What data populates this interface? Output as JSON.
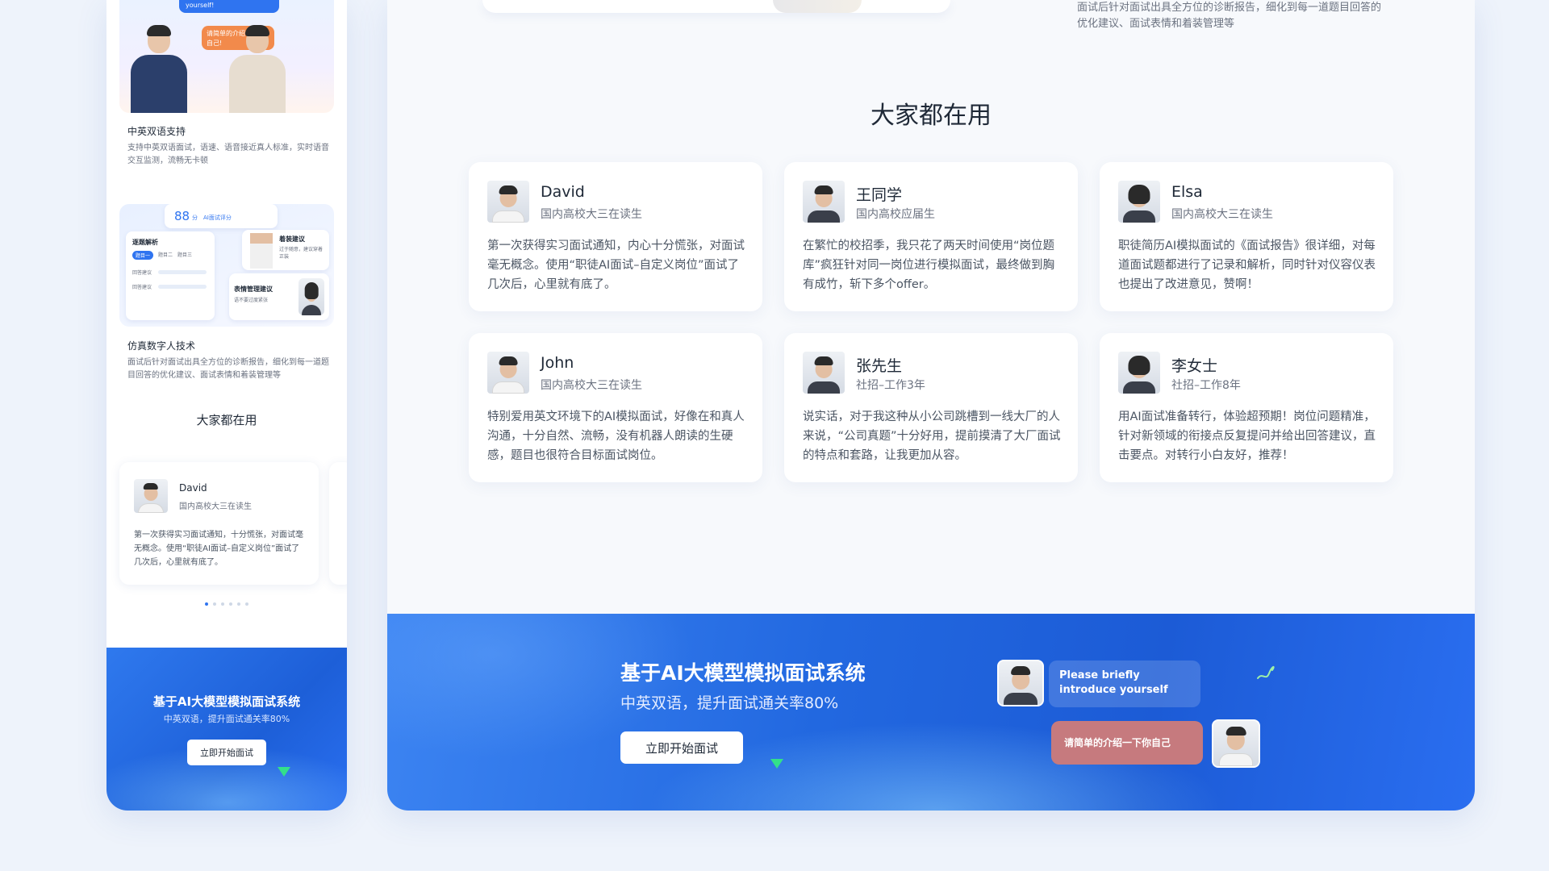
{
  "mobile": {
    "hero": {
      "bubble_en": "yourself!",
      "bubble_cn": "请简单的介绍一下你自己!"
    },
    "features": [
      {
        "title": "中英双语支持",
        "desc": "支持中英双语面试，语速、语音接近真人标准，实时语音交互监测，流畅无卡顿"
      },
      {
        "title": "仿真数字人技术",
        "desc": "面试后针对面试出具全方位的诊断报告，细化到每一道题目回答的优化建议、面试表情和着装管理等"
      }
    ],
    "report": {
      "score": "88",
      "score_unit": "分",
      "score_label": "AI面试评分",
      "analysis_title": "逐题解析",
      "tabs": [
        "题目一",
        "题目二",
        "题目三"
      ],
      "rows": [
        "回答建议",
        "回答建议"
      ],
      "dress_title": "着装建议",
      "dress_desc": "过于随意，建议穿着正装",
      "emotion_title": "表情管理建议",
      "emotion_desc": "语不要过度紧张"
    },
    "section_title": "大家都在用",
    "testimonial": {
      "name": "David",
      "role": "国内高校大三在读生",
      "quote": "第一次获得实习面试通知，十分慌张，对面试毫无概念。使用“职徒AI面试–自定义岗位”面试了几次后，心里就有底了。"
    },
    "cta": {
      "title": "基于AI大模型模拟面试系统",
      "subtitle": "中英双语，提升面试通关率80%",
      "button": "立即开始面试"
    }
  },
  "desktop": {
    "top_text": "面试后针对面试出具全方位的诊断报告，细化到每一道题目回答的优化建议、面试表情和着装管理等",
    "section_title": "大家都在用",
    "testimonials": [
      {
        "name": "David",
        "role": "国内高校大三在读生",
        "quote": "第一次获得实习面试通知，内心十分慌张，对面试毫无概念。使用“职徒AI面试–自定义岗位”面试了几次后，心里就有底了。",
        "avatar": "male"
      },
      {
        "name": "王同学",
        "role": "国内高校应届生",
        "quote": "在繁忙的校招季，我只花了两天时间使用“岗位题库”疯狂针对同一岗位进行模拟面试，最终做到胸有成竹，斩下多个offer。",
        "avatar": "male-suit"
      },
      {
        "name": "Elsa",
        "role": "国内高校大三在读生",
        "quote": "职徒简历AI模拟面试的《面试报告》很详细，对每道面试题都进行了记录和解析，同时针对仪容仪表也提出了改进意见，赞啊！",
        "avatar": "female"
      },
      {
        "name": "John",
        "role": "国内高校大三在读生",
        "quote": "特别爱用英文环境下的AI模拟面试，好像在和真人沟通，十分自然、流畅，没有机器人朗读的生硬感，题目也很符合目标面试岗位。",
        "avatar": "male-white"
      },
      {
        "name": "张先生",
        "role": "社招–工作3年",
        "quote": "说实话，对于我这种从小公司跳槽到一线大厂的人来说，“公司真题”十分好用，提前摸清了大厂面试的特点和套路，让我更加从容。",
        "avatar": "male-suit"
      },
      {
        "name": "李女士",
        "role": "社招–工作8年",
        "quote": "用AI面试准备转行，体验超预期！岗位问题精准，针对新领域的衔接点反复提问并给出回答建议，直击要点。对转行小白友好，推荐！",
        "avatar": "female"
      }
    ],
    "cta": {
      "title": "基于AI大模型模拟面试系统",
      "subtitle": "中英双语，提升面试通关率80%",
      "button": "立即开始面试",
      "chat_en": "Please briefly introduce yourself",
      "chat_cn": "请简单的介绍一下你自己"
    }
  },
  "colors": {
    "accent": "#2f74f0",
    "cta_blue": "#1d5fd8",
    "green_pointer": "#33e08a",
    "chat_cn_bubble": "#c67a7e",
    "orange_bubble": "#f28a4b"
  },
  "icons": [
    "cursor-triangle-icon",
    "squiggle-decoration-icon"
  ]
}
